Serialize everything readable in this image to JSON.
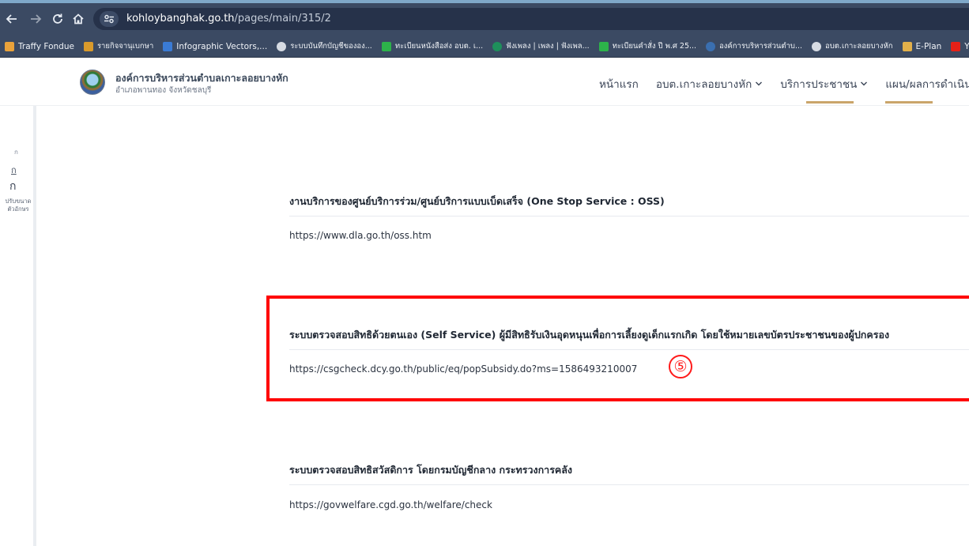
{
  "browser": {
    "url_host": "kohloybanghak.go.th",
    "url_path": "/pages/main/315/2"
  },
  "bookmarks": [
    {
      "label": "Traffy Fondue",
      "icon": "traffy-icon",
      "color": "#e9a23b"
    },
    {
      "label": "รายกิจจานุเบกษา",
      "icon": "gazette-icon",
      "color": "#d99a2b"
    },
    {
      "label": "Infographic Vectors,...",
      "icon": "star-icon",
      "color": "#3a7bd5"
    },
    {
      "label": "ระบบบันทึกบัญชีขององ...",
      "icon": "globe-icon",
      "color": "#d6dbe3"
    },
    {
      "label": "ทะเบียนหนังสือส่ง อบต. เ...",
      "icon": "cross-icon",
      "color": "#2db34a"
    },
    {
      "label": "ฟังเพลง | เพลง | ฟังเพล...",
      "icon": "music-icon",
      "color": "#1e8f5b"
    },
    {
      "label": "ทะเบียนคำสั่ง ปี พ.ศ 25...",
      "icon": "cross-icon",
      "color": "#2db34a"
    },
    {
      "label": "องค์การบริหารส่วนตำบ...",
      "icon": "seal-icon",
      "color": "#3a6fb0"
    },
    {
      "label": "อบต.เกาะลอยบางหัก",
      "icon": "globe-icon",
      "color": "#d6dbe3"
    },
    {
      "label": "E-Plan",
      "icon": "eplan-icon",
      "color": "#e2b04a"
    },
    {
      "label": "YouTube",
      "icon": "youtube-icon",
      "color": "#e62117"
    }
  ],
  "site": {
    "org_name": "องค์การบริหารส่วนตำบลเกาะลอยบางหัก",
    "org_sub": "อำเภอพานทอง จังหวัดชลบุรี",
    "nav": [
      {
        "label": "หน้าแรก",
        "dropdown": false
      },
      {
        "label": "อบต.เกาะลอยบางหัก",
        "dropdown": true
      },
      {
        "label": "บริการประชาชน",
        "dropdown": true
      },
      {
        "label": "แผน/ผลการดำเนินการ",
        "dropdown": false
      }
    ]
  },
  "font_sizer": {
    "small": "ก",
    "medium": "ก",
    "large": "ก",
    "label": "ปรับขนาดตัวอักษร"
  },
  "sections": [
    {
      "title": "งานบริการของศูนย์บริการร่วม/ศูนย์บริการแบบเบ็ดเสร็จ (One Stop Service : OSS)",
      "link": "https://www.dla.go.th/oss.htm",
      "highlighted": false
    },
    {
      "title": "ระบบตรวจสอบสิทธิด้วยตนเอง (Self Service) ผู้มีสิทธิรับเงินอุดหนุนเพื่อการเลี้ยงดูเด็กแรกเกิด โดยใช้หมายเลขบัตรประชาชนของผู้ปกครอง",
      "link": "https://csgcheck.dcy.go.th/public/eq/popSubsidy.do?ms=1586493210007",
      "highlighted": true
    },
    {
      "title": "ระบบตรวจสอบสิทธิสวัสดิการ โดยกรมบัญชีกลาง กระทรวงการคลัง",
      "link": "https://govwelfare.cgd.go.th/welfare/check",
      "highlighted": false
    }
  ],
  "annotation": {
    "marker_label": "⑤",
    "color": "#ff0000"
  }
}
